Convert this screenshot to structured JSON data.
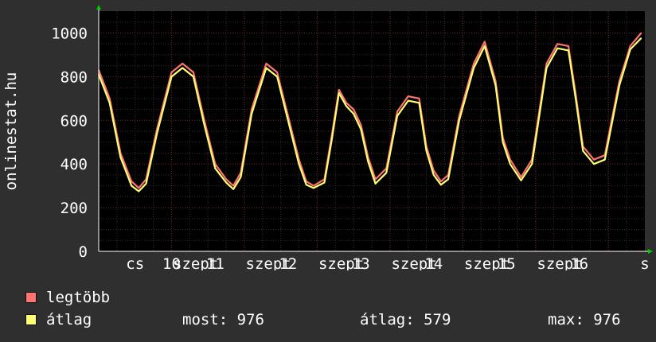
{
  "chart_data": {
    "type": "line",
    "ylabel": "onlinestat.hu",
    "ylim": [
      0,
      1100
    ],
    "yticks": [
      0,
      200,
      400,
      600,
      800,
      1000
    ],
    "grid": true,
    "x_tick_labels": [
      "cs",
      "10",
      "szept",
      "11",
      "szept",
      "12",
      "szept",
      "13",
      "szept",
      "14",
      "szept",
      "15",
      "szept",
      "16",
      "s"
    ],
    "x_tick_positions": [
      0.5,
      1,
      1.33,
      1.6,
      2.33,
      2.6,
      3.33,
      3.6,
      4.33,
      4.6,
      5.33,
      5.6,
      6.33,
      6.6,
      7.5
    ],
    "x_range": [
      0,
      7.5
    ],
    "series": [
      {
        "name": "legtöbb",
        "color": "#ff7373",
        "x": [
          0,
          0.15,
          0.3,
          0.45,
          0.55,
          0.65,
          0.8,
          1.0,
          1.15,
          1.3,
          1.45,
          1.6,
          1.75,
          1.85,
          1.95,
          2.1,
          2.3,
          2.45,
          2.6,
          2.75,
          2.85,
          2.95,
          3.1,
          3.2,
          3.3,
          3.4,
          3.5,
          3.6,
          3.7,
          3.8,
          3.95,
          4.1,
          4.25,
          4.4,
          4.5,
          4.6,
          4.7,
          4.8,
          4.95,
          5.15,
          5.3,
          5.45,
          5.55,
          5.65,
          5.8,
          5.95,
          6.15,
          6.3,
          6.45,
          6.55,
          6.65,
          6.8,
          6.95,
          7.15,
          7.3,
          7.45
        ],
        "values": [
          830,
          700,
          450,
          320,
          290,
          330,
          560,
          820,
          860,
          820,
          600,
          400,
          330,
          300,
          360,
          650,
          860,
          820,
          620,
          420,
          320,
          300,
          330,
          530,
          740,
          680,
          650,
          580,
          430,
          330,
          380,
          640,
          710,
          700,
          480,
          370,
          320,
          350,
          620,
          860,
          960,
          780,
          520,
          420,
          340,
          420,
          860,
          950,
          940,
          720,
          480,
          420,
          440,
          780,
          940,
          1000
        ]
      },
      {
        "name": "átlag",
        "color": "#ffff73",
        "x": [
          0,
          0.15,
          0.3,
          0.45,
          0.55,
          0.65,
          0.8,
          1.0,
          1.15,
          1.3,
          1.45,
          1.6,
          1.75,
          1.85,
          1.95,
          2.1,
          2.3,
          2.45,
          2.6,
          2.75,
          2.85,
          2.95,
          3.1,
          3.2,
          3.3,
          3.4,
          3.5,
          3.6,
          3.7,
          3.8,
          3.95,
          4.1,
          4.25,
          4.4,
          4.5,
          4.6,
          4.7,
          4.8,
          4.95,
          5.15,
          5.3,
          5.45,
          5.55,
          5.65,
          5.8,
          5.95,
          6.15,
          6.3,
          6.45,
          6.55,
          6.65,
          6.8,
          6.95,
          7.15,
          7.3,
          7.45
        ],
        "values": [
          810,
          680,
          430,
          300,
          275,
          310,
          540,
          800,
          840,
          800,
          580,
          380,
          315,
          285,
          340,
          630,
          840,
          800,
          600,
          400,
          305,
          290,
          315,
          510,
          725,
          665,
          630,
          560,
          410,
          310,
          360,
          620,
          690,
          680,
          460,
          350,
          305,
          330,
          600,
          840,
          940,
          760,
          500,
          400,
          325,
          400,
          840,
          930,
          920,
          700,
          460,
          400,
          420,
          760,
          925,
          976
        ]
      }
    ]
  },
  "legend": [
    {
      "label": "legtöbb",
      "color": "#ff7373"
    },
    {
      "label": "átlag",
      "color": "#ffff73"
    }
  ],
  "stats": {
    "most": "most: 976",
    "atlag": "átlag: 579",
    "max": "max: 976"
  }
}
